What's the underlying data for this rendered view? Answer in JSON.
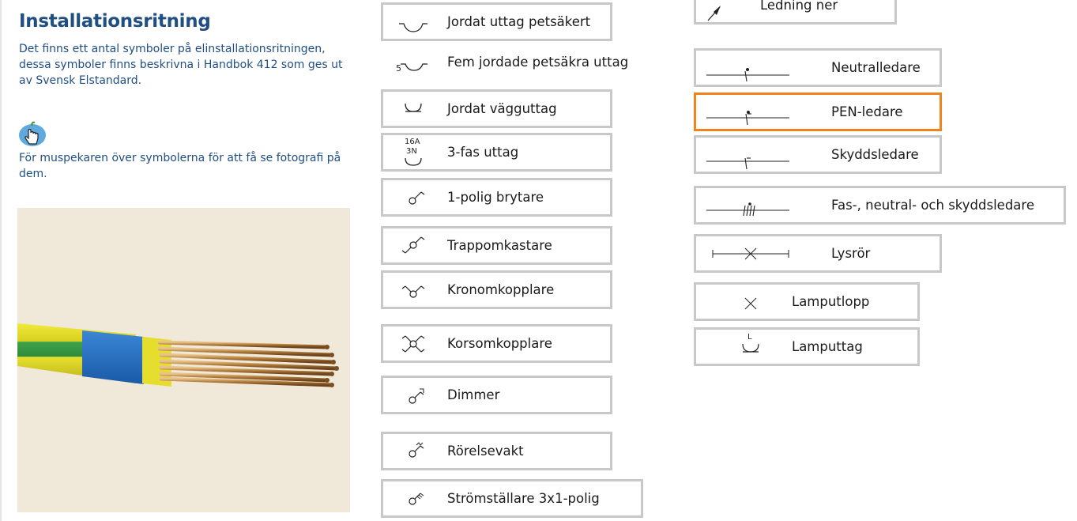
{
  "page": {
    "title": "Installationsritning",
    "intro": "Det finns ett antal symboler på elinstallationsritningen, dessa symboler finns beskrivna i Handbok 412 som ges ut av Svensk Elstandard.",
    "hint": "För muspekaren över symbolerna för att få se fotografi på dem.",
    "hint_icon": "pointer-hand-icon",
    "photo": "cable-photo"
  },
  "colors": {
    "heading": "#1f4e83",
    "border": "#c8c8c8",
    "active_border": "#f0831e",
    "photo_background": "#f0e8d8"
  },
  "symbols_col1": [
    {
      "label": "Jordat uttag petsäkert",
      "icon": "childproof-grounded-outlet-icon"
    },
    {
      "label": "Fem jordade petsäkra uttag",
      "icon": "five-outlets-icon",
      "icon_text": "5"
    },
    {
      "label": "Jordat vägguttag",
      "icon": "grounded-wall-outlet-icon"
    },
    {
      "label": "3-fas uttag",
      "icon": "three-phase-outlet-icon",
      "icon_text_1": "16A",
      "icon_text_2": "3N"
    },
    {
      "label": "1-polig brytare",
      "icon": "single-pole-switch-icon"
    },
    {
      "label": "Trappomkastare",
      "icon": "staircase-switch-icon"
    },
    {
      "label": "Kronomkopplare",
      "icon": "chandelier-switch-icon"
    },
    {
      "label": "Korsomkopplare",
      "icon": "cross-switch-icon"
    },
    {
      "label": "Dimmer",
      "icon": "dimmer-icon"
    },
    {
      "label": "Rörelsevakt",
      "icon": "motion-sensor-icon"
    },
    {
      "label": "Strömställare 3x1-polig",
      "icon": "triple-switch-icon"
    }
  ],
  "symbols_col2": [
    {
      "label": "Ledning ner",
      "icon": "wire-down-icon"
    },
    {
      "label": "Neutralledare",
      "icon": "neutral-conductor-icon"
    },
    {
      "label": "PEN-ledare",
      "icon": "pen-conductor-icon",
      "active": true
    },
    {
      "label": "Skyddsledare",
      "icon": "protective-conductor-icon"
    },
    {
      "label": "Fas-, neutral- och skyddsledare",
      "icon": "phase-neutral-protective-icon"
    },
    {
      "label": "Lysrör",
      "icon": "fluorescent-tube-icon"
    },
    {
      "label": "Lamputlopp",
      "icon": "lamp-outlet-icon"
    },
    {
      "label": "Lamputtag",
      "icon": "lamp-socket-icon",
      "icon_text": "L"
    }
  ]
}
